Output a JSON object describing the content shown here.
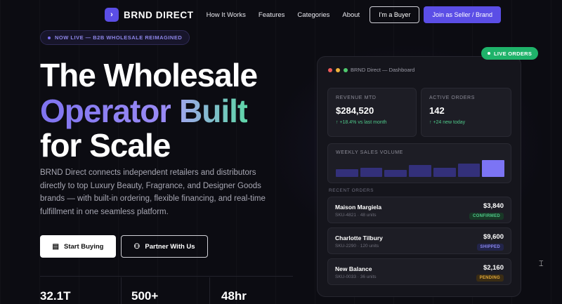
{
  "nav": {
    "brand_icon": "›",
    "brand": "BRND DIRECT",
    "links": [
      "How It Works",
      "Features",
      "Categories",
      "About"
    ],
    "buyer_btn": "I'm a Buyer",
    "seller_btn": "Join as Seller / Brand"
  },
  "hero": {
    "pill": "NOW LIVE — B2B WHOLESALE REIMAGINED",
    "line1": "The Wholesale",
    "line2a": "Operator",
    "line2b": "Built",
    "line3": "for Scale",
    "description": "BRND Direct connects independent retailers and distributors directly to top Luxury Beauty, Fragrance, and Designer Goods brands — with built-in ordering, flexible financing, and real-time fulfillment in one seamless platform.",
    "cta_primary": "Start Buying",
    "cta_primary_icon": "storefront-icon",
    "cta_secondary": "Partner With Us",
    "cta_secondary_icon": "handshake-icon",
    "stats": [
      "32.1T",
      "500+",
      "48hr"
    ]
  },
  "dashboard": {
    "live_badge": "LIVE ORDERS",
    "title": "BRND Direct — Dashboard",
    "revenue": {
      "label": "REVENUE MTD",
      "value": "$284,520",
      "delta": "↑ +18.4% vs last month"
    },
    "active": {
      "label": "ACTIVE ORDERS",
      "value": "142",
      "delta": "↑ +24 new today"
    },
    "chart": {
      "label": "WEEKLY SALES VOLUME",
      "values": [
        45,
        55,
        40,
        70,
        55,
        80,
        100
      ],
      "highlight_index": 6
    },
    "recent_label": "RECENT ORDERS",
    "orders": [
      {
        "name": "Maison Margiela",
        "sku": "SKU-4821 · 48 units",
        "amount": "$3,840",
        "status": "CONFIRMED"
      },
      {
        "name": "Charlotte Tilbury",
        "sku": "SKU-2290 · 120 units",
        "amount": "$9,600",
        "status": "SHIPPED"
      },
      {
        "name": "New Balance",
        "sku": "SKU-0033 · 36 units",
        "amount": "$2,160",
        "status": "PENDING"
      }
    ]
  },
  "colors": {
    "accent": "#5b4ee6",
    "live": "#1fb36a",
    "confirmed_bg": "#183826",
    "confirmed_fg": "#4fc98a",
    "shipped_bg": "#22244a",
    "shipped_fg": "#8c88f0",
    "pending_bg": "#3a2c14",
    "pending_fg": "#e0a83a"
  }
}
